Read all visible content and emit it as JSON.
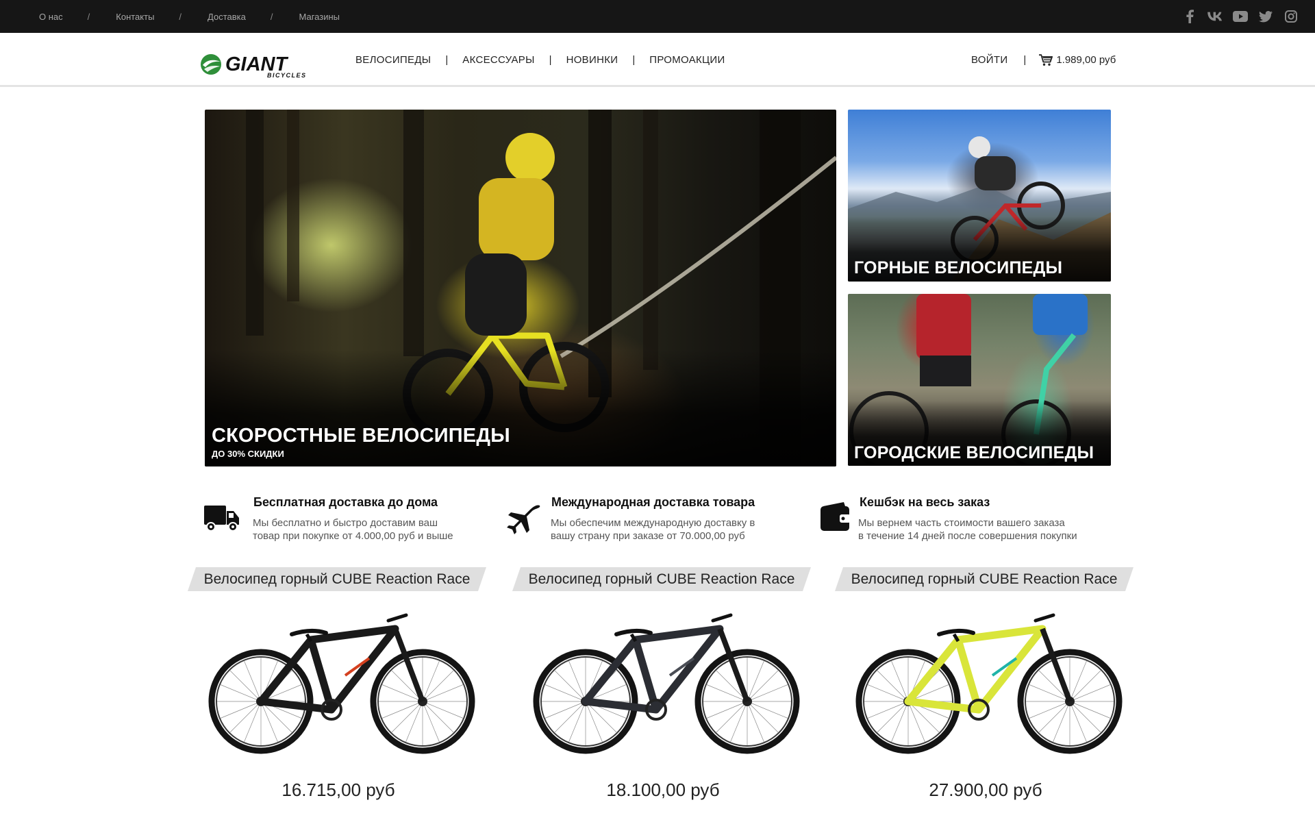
{
  "topbar": {
    "links": [
      "О нас",
      "Контакты",
      "Доставка",
      "Магазины"
    ],
    "separator": "/",
    "social_icons": [
      "facebook-icon",
      "vk-icon",
      "youtube-icon",
      "twitter-icon",
      "instagram-icon"
    ]
  },
  "header": {
    "logo_alt": "GIANT",
    "logo_main": "GIANT",
    "logo_sub": "BICYCLES",
    "nav": [
      "ВЕЛОСИПЕДЫ",
      "АКСЕССУАРЫ",
      "НОВИНКИ",
      "ПРОМОАКЦИИ"
    ],
    "separator": "|",
    "login": "ВОЙТИ",
    "cart_total": "1.989,00 руб"
  },
  "promos": {
    "main": {
      "title": "СКОРОСТНЫЕ ВЕЛОСИПЕДЫ",
      "subtitle": "ДО 30% СКИДКИ"
    },
    "mountain": {
      "title": "ГОРНЫЕ ВЕЛОСИПЕДЫ"
    },
    "city": {
      "title": "ГОРОДСКИЕ ВЕЛОСИПЕДЫ"
    }
  },
  "benefits": [
    {
      "icon": "truck-icon",
      "title": "Бесплатная доставка до дома",
      "line1": "Мы бесплатно и быстро доставим ваш",
      "line2": "товар при покупке от 4.000,00 руб и выше"
    },
    {
      "icon": "airplane-icon",
      "title": "Международная доставка товара",
      "line1": "Мы обеспечим международную доставку в",
      "line2": "вашу страну при заказе от 70.000,00 руб"
    },
    {
      "icon": "wallet-icon",
      "title": "Кешбэк на весь заказ",
      "line1": "Мы вернем часть стоимости вашего заказа",
      "line2": "в течение 14 дней после совершения покупки"
    }
  ],
  "products": [
    {
      "title": "Велосипед горный CUBE Reaction Race",
      "price": "16.715,00 руб",
      "frame_color": "#1a1a1a",
      "accent_color": "#d4401f"
    },
    {
      "title": "Велосипед горный CUBE Reaction Race",
      "price": "18.100,00 руб",
      "frame_color": "#2b2d33",
      "accent_color": "#4a4d55"
    },
    {
      "title": "Велосипед горный CUBE Reaction Race",
      "price": "27.900,00 руб",
      "frame_color": "#d9e53a",
      "accent_color": "#1fb3a8"
    }
  ]
}
